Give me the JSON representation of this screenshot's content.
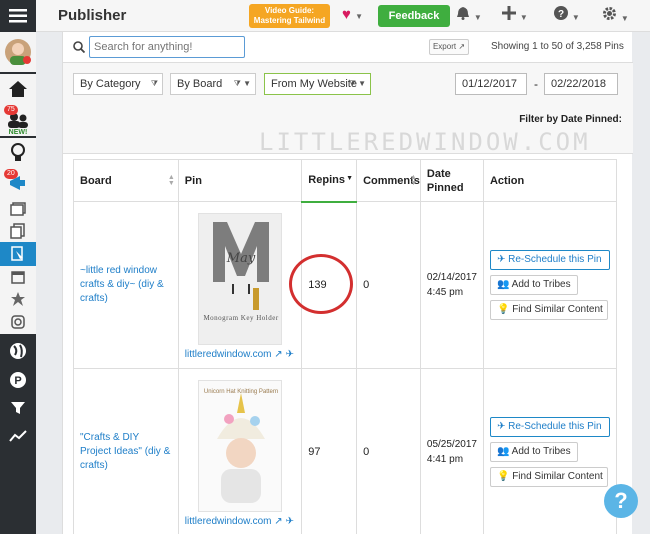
{
  "header": {
    "title": "Publisher",
    "guide_line1": "Video Guide:",
    "guide_line2": "Mastering Tailwind",
    "feedback_label": "Feedback"
  },
  "sidebar": {
    "badge_tribes": "75",
    "badge_promote": "20",
    "new_label": "NEW!"
  },
  "search": {
    "placeholder": "Search for anything!"
  },
  "toolbar": {
    "export_label": "Export",
    "showing_text": "Showing 1 to 50 of 3,258 Pins"
  },
  "filters": {
    "category": "By Category",
    "board": "By Board",
    "website": "From My Website",
    "date_from": "01/12/2017",
    "date_to": "02/22/2018",
    "date_label": "Filter by Date Pinned:"
  },
  "watermark": "LITTLEREDWINDOW.COM",
  "table": {
    "headers": [
      "Board",
      "Pin",
      "Repins",
      "Comments",
      "Date Pinned",
      "Action"
    ],
    "rows": [
      {
        "board": "~little red window crafts & diy~ (diy & crafts)",
        "pin_caption": "Monogram Key Holder",
        "pin_site": "littleredwindow.com",
        "repins": "139",
        "comments": "0",
        "date": "02/14/2017",
        "time": "4:45 pm",
        "actions": [
          "Re-Schedule this Pin",
          "Add to Tribes",
          "Find Similar Content"
        ]
      },
      {
        "board": "\"Crafts & DIY Project Ideas\" (diy & crafts)",
        "pin_caption": "Unicorn Hat Knitting Pattern",
        "pin_site": "littleredwindow.com",
        "repins": "97",
        "comments": "0",
        "date": "05/25/2017",
        "time": "4:41 pm",
        "actions": [
          "Re-Schedule this Pin",
          "Add to Tribes",
          "Find Similar Content"
        ]
      }
    ]
  },
  "colors": {
    "accent": "#1e88c7",
    "feedback": "#3fae3f",
    "guide": "#f5a623",
    "sidebar": "#2b2f33",
    "highlight": "#d32f2f"
  }
}
